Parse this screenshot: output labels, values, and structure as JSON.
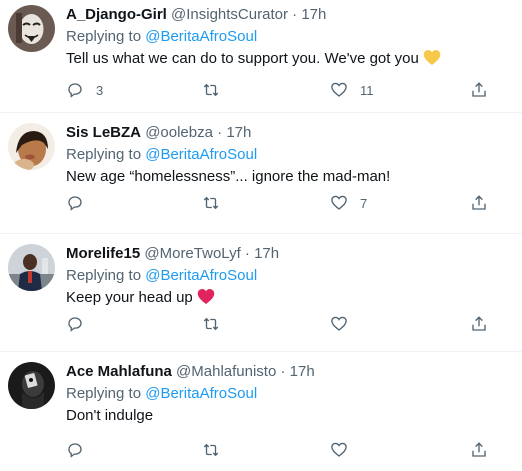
{
  "tweets": [
    {
      "name": "A_Django-Girl",
      "handle": "@InsightsCurator",
      "dot": "·",
      "time": "17h",
      "replying_prefix": "Replying to",
      "replying_to": "@BeritaAfroSoul",
      "text": "Tell us what we can do to support you. We've got you",
      "emoji": "yellow-heart",
      "reply_count": "3",
      "like_count": "11"
    },
    {
      "name": "Sis LeBZA",
      "handle": "@oolebza",
      "dot": "·",
      "time": "17h",
      "replying_prefix": "Replying to",
      "replying_to": "@BeritaAfroSoul",
      "text": "New age “homelessness”... ignore the mad-man!",
      "reply_count": "",
      "like_count": "7"
    },
    {
      "name": "Morelife15",
      "handle": "@MoreTwoLyf",
      "dot": "·",
      "time": "17h",
      "replying_prefix": "Replying to",
      "replying_to": "@BeritaAfroSoul",
      "text": "Keep your head up",
      "emoji": "red-heart",
      "reply_count": "",
      "like_count": ""
    },
    {
      "name": "Ace Mahlafuna",
      "handle": "@Mahlafunisto",
      "dot": "·",
      "time": "17h",
      "replying_prefix": "Replying to",
      "replying_to": "@BeritaAfroSoul",
      "text": "Don't indulge",
      "reply_count": "",
      "like_count": ""
    }
  ],
  "colors": {
    "accent": "#1d9bf0",
    "secondary_text": "#536471",
    "primary_text": "#0f1419",
    "divider": "#eff3f4",
    "yellow_heart": "#f7c948",
    "red_heart": "#e0245e"
  }
}
